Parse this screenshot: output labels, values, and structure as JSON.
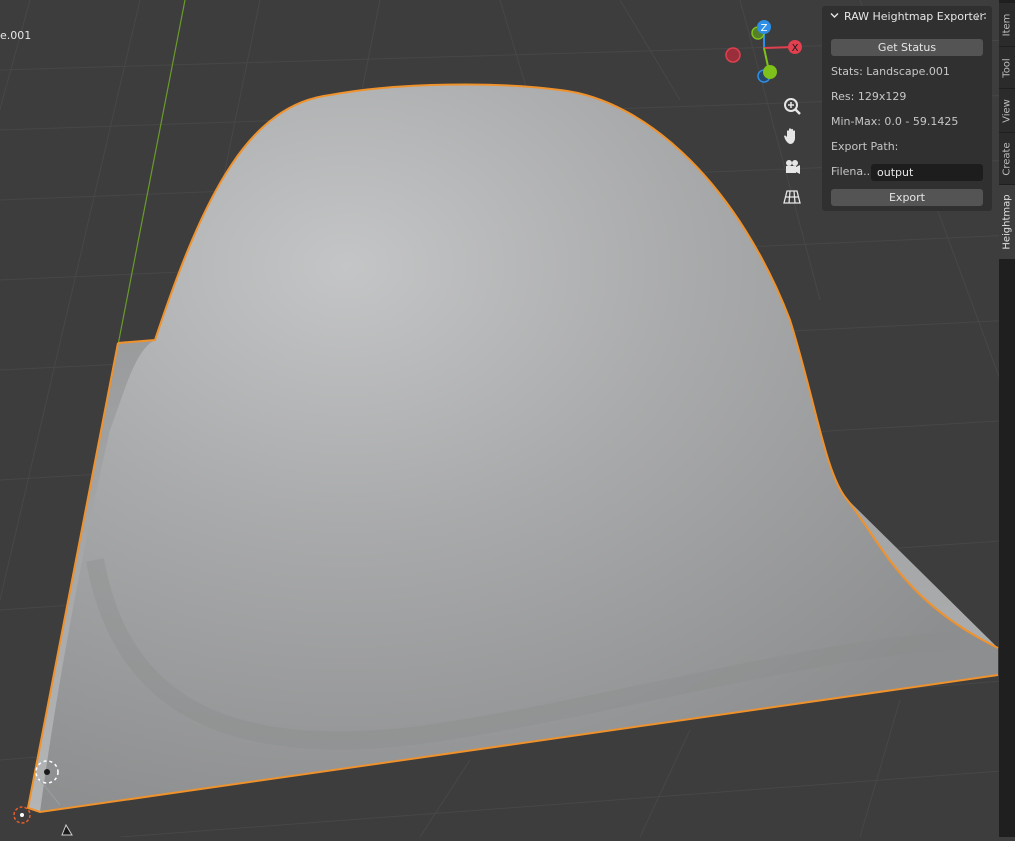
{
  "viewport": {
    "object_name_partial": "e.001"
  },
  "panel": {
    "title": "RAW Heightmap Exporter",
    "get_status_label": "Get Status",
    "stats_line": "Stats: Landscape.001",
    "res_line": "Res: 129x129",
    "minmax_line": "Min-Max: 0.0 - 59.1425",
    "export_path_label": "Export Path:",
    "filename_label": "Filena...",
    "filename_value": "output",
    "export_label": "Export"
  },
  "sidebar_tabs": [
    "Item",
    "Tool",
    "View",
    "Create",
    "Heightmap"
  ],
  "gizmo": {
    "z_label": "Z",
    "x_label": "X"
  },
  "nav_icons": [
    "zoom-icon",
    "hand-pan-icon",
    "camera-icon",
    "perspective-grid-icon"
  ],
  "colors": {
    "selection_outline": "#f0922c",
    "axis_x": "#e0404f",
    "axis_y": "#7ec11a",
    "axis_z": "#2e8fe6",
    "panel_bg": "#303030",
    "button_bg": "#545454",
    "viewport_bg": "#3d3d3d"
  }
}
